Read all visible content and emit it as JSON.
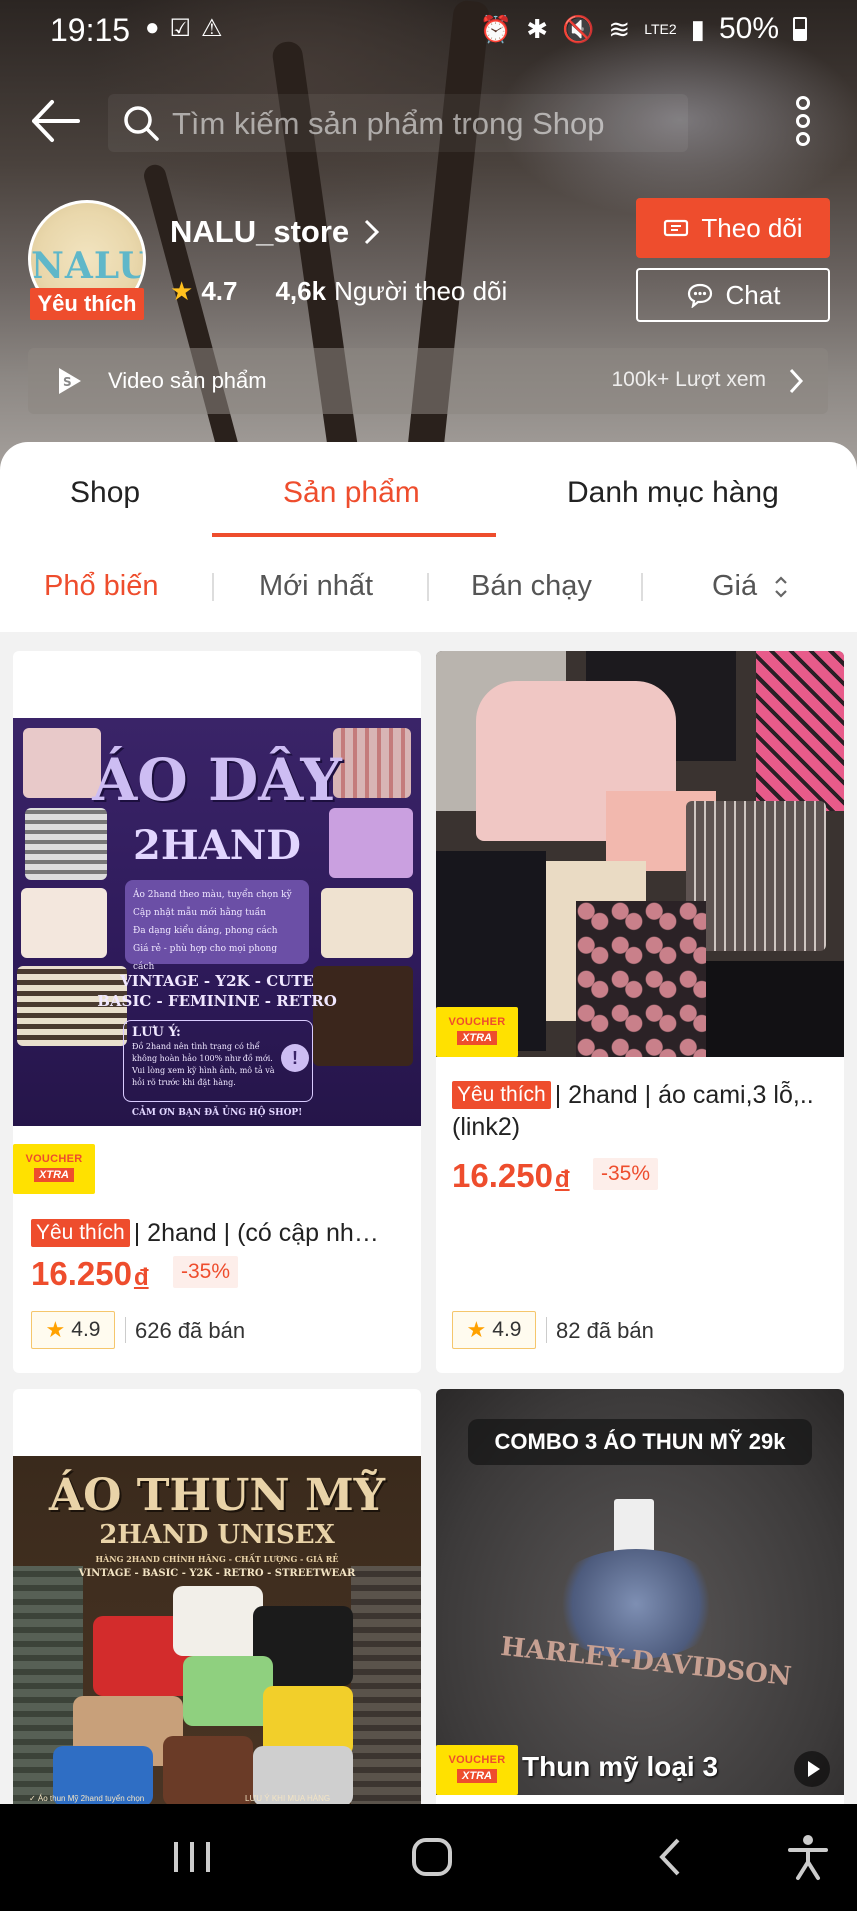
{
  "status_bar": {
    "time": "19:15",
    "left_icons": [
      "messenger-icon",
      "check-square-icon",
      "warning-icon"
    ],
    "right_icons": [
      "alarm-icon",
      "bluetooth-icon",
      "mute-icon",
      "wifi-icon",
      "volte-icon",
      "signal-icon"
    ],
    "battery": "50%"
  },
  "topbar": {
    "search_placeholder": "Tìm kiếm sản phẩm trong Shop"
  },
  "shop": {
    "logo_text": "NALU",
    "favorite_badge": "Yêu thích",
    "name": "NALU_store",
    "rating": "4.7",
    "followers": "4,6k",
    "followers_label": "Người theo dõi",
    "follow_button": "Theo dõi",
    "chat_button": "Chat",
    "video_label": "Video sản phẩm",
    "video_views": "100k+ Lượt xem"
  },
  "tabs": [
    {
      "label": "Shop",
      "active": false
    },
    {
      "label": "Sản phẩm",
      "active": true
    },
    {
      "label": "Danh mục hàng",
      "active": false
    }
  ],
  "sort_options": [
    {
      "label": "Phổ biến",
      "active": true
    },
    {
      "label": "Mới nhất",
      "active": false
    },
    {
      "label": "Bán chạy",
      "active": false
    },
    {
      "label": "Giá",
      "active": false
    }
  ],
  "products": [
    {
      "image_title_1": "ÁO DÂY",
      "image_title_2": "2HAND",
      "image_lines": [
        "Áo 2hand theo màu, tuyển chọn kỹ",
        "Cập nhật mẫu mới hằng tuần",
        "Đa dạng kiểu dáng, phong cách",
        "Giá rẻ - phù hợp cho mọi phong cách"
      ],
      "image_tags_1": "VINTAGE - Y2K - CUTE",
      "image_tags_2": "BASIC - FEMININE - RETRO",
      "image_note_title": "LƯU Ý:",
      "image_note": "Đồ 2hand nên tình trạng có thể không hoàn hảo 100% như đồ mới. Vui lòng xem kỹ hình ảnh, mô tả và hỏi rõ trước khi đặt hàng.",
      "image_footer": "CẢM ƠN BẠN ĐÃ ỦNG HỘ SHOP!",
      "voucher_1": "VOUCHER",
      "voucher_2": "XTRA",
      "favorite_badge": "Yêu thích",
      "title": "| 2hand | (có cập nh…",
      "price": "16.250",
      "currency": "đ",
      "discount": "-35%",
      "rating": "4.9",
      "sold": "626 đã bán"
    },
    {
      "voucher_1": "VOUCHER",
      "voucher_2": "XTRA",
      "favorite_badge": "Yêu thích",
      "title": "| 2hand | áo cami,3 lỗ,..(link2)",
      "price": "16.250",
      "currency": "đ",
      "discount": "-35%",
      "rating": "4.9",
      "sold": "82 đã bán"
    },
    {
      "image_title_1": "ÁO THUN MỸ",
      "image_title_2": "2HAND UNISEX",
      "image_sub": "HÀNG 2HAND CHÍNH HÃNG - CHẤT LƯỢNG - GIÁ RẺ",
      "image_tags": "VINTAGE - BASIC - Y2K - RETRO - STREETWEAR",
      "image_footer_left": "✓ Áo thun Mỹ 2hand tuyển chọn",
      "image_footer_right": "LƯU Ý KHI MUA HÀNG"
    },
    {
      "image_banner": "COMBO 3 ÁO THUN MỸ 29k",
      "image_shirt_text": "HARLEY-DAVIDSON",
      "image_caption": "Thun mỹ loại 3",
      "voucher_1": "VOUCHER",
      "voucher_2": "XTRA"
    }
  ],
  "colors": {
    "accent": "#ee4d2d",
    "voucher_yellow": "#ffe100",
    "star": "#ffc01e"
  }
}
